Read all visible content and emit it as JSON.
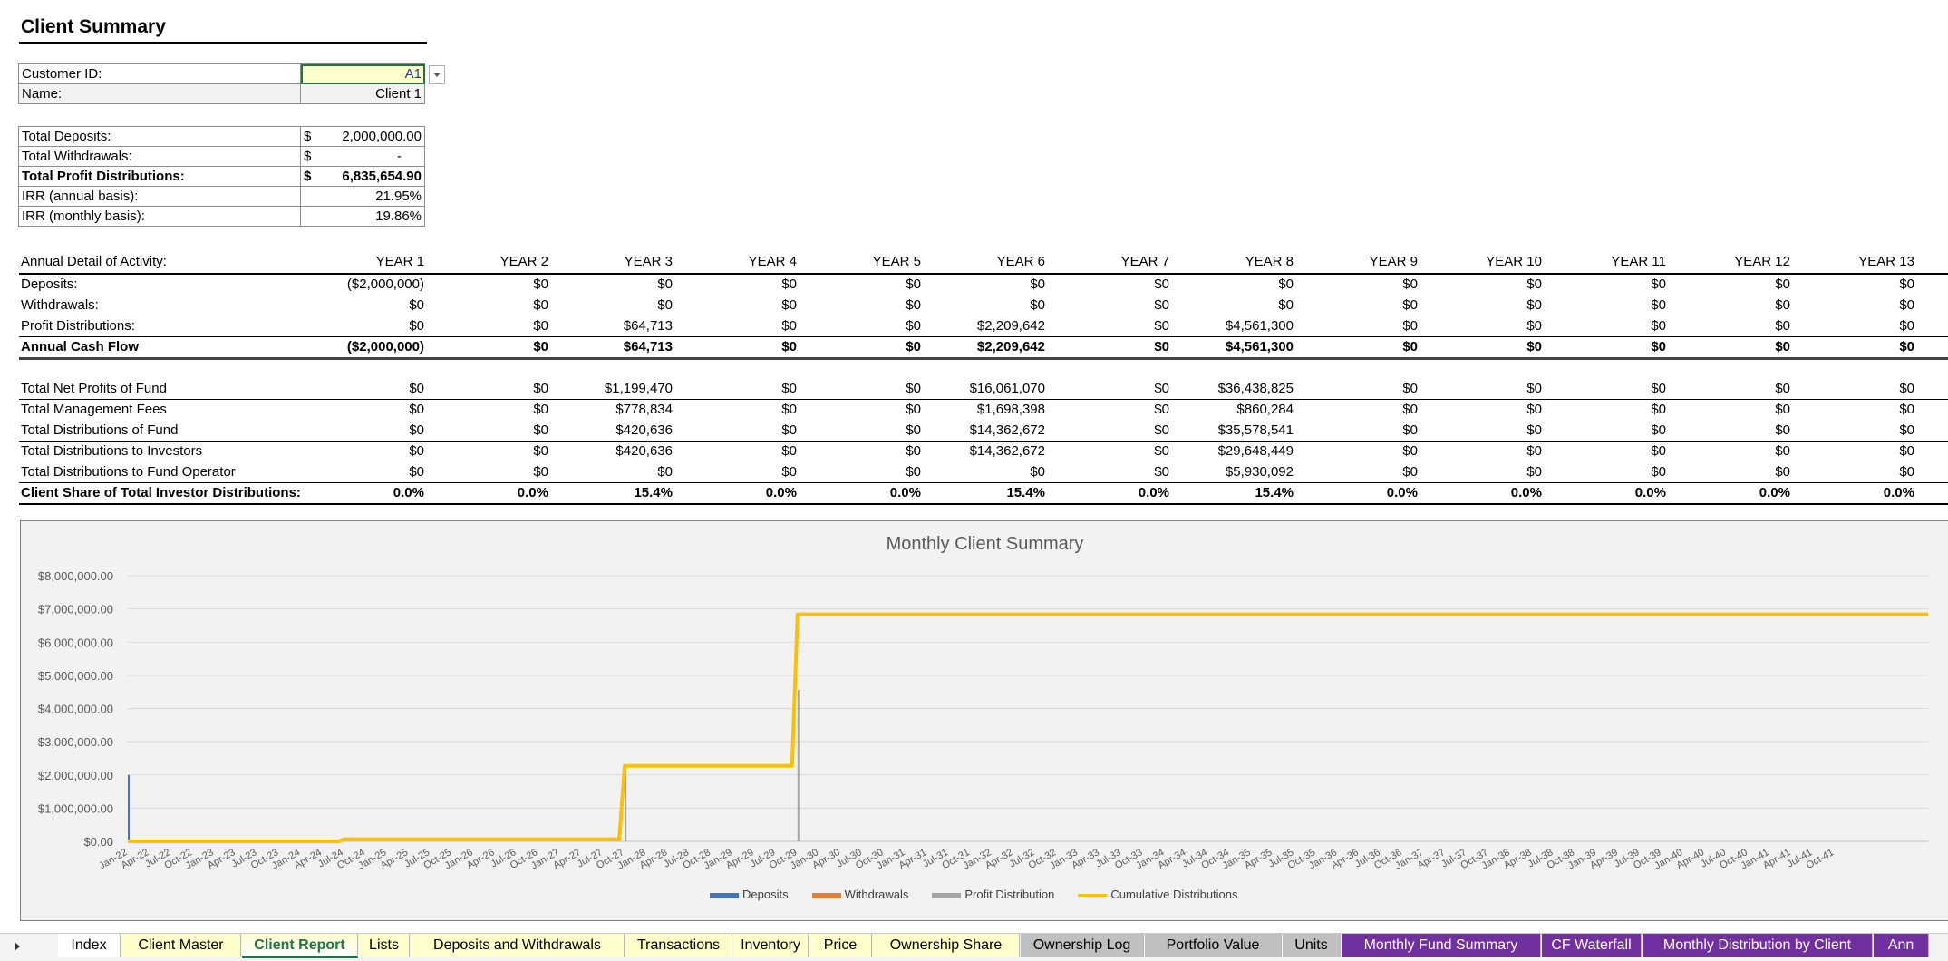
{
  "title": "Client Summary",
  "customer": {
    "id_label": "Customer ID:",
    "id_value": "A1",
    "name_label": "Name:",
    "name_value": "Client 1"
  },
  "totals": [
    {
      "label": "Total Deposits:",
      "currency": "$",
      "amount": "2,000,000.00",
      "bold": false
    },
    {
      "label": "Total Withdrawals:",
      "currency": "$",
      "amount": "-",
      "bold": false
    },
    {
      "label": "Total Profit Distributions:",
      "currency": "$",
      "amount": "6,835,654.90",
      "bold": true
    },
    {
      "label": "IRR (annual basis):",
      "currency": "",
      "amount": "21.95%",
      "bold": false
    },
    {
      "label": "IRR (monthly basis):",
      "currency": "",
      "amount": "19.86%",
      "bold": false
    }
  ],
  "annual": {
    "header_label": "Annual Detail of Activity:",
    "years": [
      "YEAR 1",
      "YEAR 2",
      "YEAR 3",
      "YEAR 4",
      "YEAR 5",
      "YEAR 6",
      "YEAR 7",
      "YEAR 8",
      "YEAR 9",
      "YEAR 10",
      "YEAR 11",
      "YEAR 12",
      "YEAR 13"
    ],
    "rows": [
      {
        "label": "Deposits:",
        "bold": false,
        "values": [
          "($2,000,000)",
          "$0",
          "$0",
          "$0",
          "$0",
          "$0",
          "$0",
          "$0",
          "$0",
          "$0",
          "$0",
          "$0",
          "$0"
        ]
      },
      {
        "label": "Withdrawals:",
        "bold": false,
        "values": [
          "$0",
          "$0",
          "$0",
          "$0",
          "$0",
          "$0",
          "$0",
          "$0",
          "$0",
          "$0",
          "$0",
          "$0",
          "$0"
        ]
      },
      {
        "label": "Profit Distributions:",
        "bold": false,
        "values": [
          "$0",
          "$0",
          "$64,713",
          "$0",
          "$0",
          "$2,209,642",
          "$0",
          "$4,561,300",
          "$0",
          "$0",
          "$0",
          "$0",
          "$0"
        ]
      },
      {
        "label": "Annual Cash Flow",
        "bold": true,
        "values": [
          "($2,000,000)",
          "$0",
          "$64,713",
          "$0",
          "$0",
          "$2,209,642",
          "$0",
          "$4,561,300",
          "$0",
          "$0",
          "$0",
          "$0",
          "$0"
        ]
      }
    ],
    "fund_rows": [
      {
        "label": "Total Net Profits of Fund",
        "bold": false,
        "values": [
          "$0",
          "$0",
          "$1,199,470",
          "$0",
          "$0",
          "$16,061,070",
          "$0",
          "$36,438,825",
          "$0",
          "$0",
          "$0",
          "$0",
          "$0"
        ]
      },
      {
        "label": " Total Management Fees",
        "bold": false,
        "values": [
          "$0",
          "$0",
          "$778,834",
          "$0",
          "$0",
          "$1,698,398",
          "$0",
          "$860,284",
          "$0",
          "$0",
          "$0",
          "$0",
          "$0"
        ]
      },
      {
        "label": " Total Distributions of Fund",
        "bold": false,
        "values": [
          "$0",
          "$0",
          "$420,636",
          "$0",
          "$0",
          "$14,362,672",
          "$0",
          "$35,578,541",
          "$0",
          "$0",
          "$0",
          "$0",
          "$0"
        ]
      },
      {
        "label": " Total Distributions to Investors",
        "bold": false,
        "values": [
          "$0",
          "$0",
          "$420,636",
          "$0",
          "$0",
          "$14,362,672",
          "$0",
          "$29,648,449",
          "$0",
          "$0",
          "$0",
          "$0",
          "$0"
        ]
      },
      {
        "label": " Total Distributions to Fund Operator",
        "bold": false,
        "values": [
          "$0",
          "$0",
          "$0",
          "$0",
          "$0",
          "$0",
          "$0",
          "$5,930,092",
          "$0",
          "$0",
          "$0",
          "$0",
          "$0"
        ]
      },
      {
        "label": "Client Share of Total Investor Distributions:",
        "bold": true,
        "values": [
          "0.0%",
          "0.0%",
          "15.4%",
          "0.0%",
          "0.0%",
          "15.4%",
          "0.0%",
          "15.4%",
          "0.0%",
          "0.0%",
          "0.0%",
          "0.0%",
          "0.0%"
        ]
      }
    ]
  },
  "chart_data": {
    "type": "line",
    "title": "Monthly Client Summary",
    "y_ticks": [
      "$0.00",
      "$1,000,000.00",
      "$2,000,000.00",
      "$3,000,000.00",
      "$4,000,000.00",
      "$5,000,000.00",
      "$6,000,000.00",
      "$7,000,000.00",
      "$8,000,000.00"
    ],
    "ylim": [
      0,
      8000000
    ],
    "x_labels": [
      "Jan-22",
      "Apr-22",
      "Jul-22",
      "Oct-22",
      "Jan-23",
      "Apr-23",
      "Jul-23",
      "Oct-23",
      "Jan-24",
      "Apr-24",
      "Jul-24",
      "Oct-24",
      "Jan-25",
      "Apr-25",
      "Jul-25",
      "Oct-25",
      "Jan-26",
      "Apr-26",
      "Jul-26",
      "Oct-26",
      "Jan-27",
      "Apr-27",
      "Jul-27",
      "Oct-27",
      "Jan-28",
      "Apr-28",
      "Jul-28",
      "Oct-28",
      "Jan-29",
      "Apr-29",
      "Jul-29",
      "Oct-29",
      "Jan-30",
      "Apr-30",
      "Jul-30",
      "Oct-30",
      "Jan-31",
      "Apr-31",
      "Jul-31",
      "Oct-31",
      "Jan-32",
      "Apr-32",
      "Jul-32",
      "Oct-32",
      "Jan-33",
      "Apr-33",
      "Jul-33",
      "Oct-33",
      "Jan-34",
      "Apr-34",
      "Jul-34",
      "Oct-34",
      "Jan-35",
      "Apr-35",
      "Jul-35",
      "Oct-35",
      "Jan-36",
      "Apr-36",
      "Jul-36",
      "Oct-36",
      "Jan-37",
      "Apr-37",
      "Jul-37",
      "Oct-37",
      "Jan-38",
      "Apr-38",
      "Jul-38",
      "Oct-38",
      "Jan-39",
      "Apr-39",
      "Jul-39",
      "Oct-39",
      "Jan-40",
      "Apr-40",
      "Jul-40",
      "Oct-40",
      "Jan-41",
      "Apr-41",
      "Jul-41",
      "Oct-41"
    ],
    "series": [
      {
        "name": "Deposits",
        "color": "#4472c4",
        "points": [
          {
            "x": "Jan-22",
            "y": 2000000
          }
        ]
      },
      {
        "name": "Withdrawals",
        "color": "#ed7d31",
        "points": []
      },
      {
        "name": "Profit Distribution",
        "color": "#a5a5a5",
        "points": [
          {
            "x": "Oct-27",
            "y": 2300000
          },
          {
            "x": "Oct-29",
            "y": 4560000
          }
        ]
      },
      {
        "name": "Cumulative Distributions",
        "color": "#ffc000",
        "steps": [
          {
            "from": "Jan-22",
            "y": 0
          },
          {
            "from": "Jul-24",
            "y": 64713
          },
          {
            "from": "Oct-27",
            "y": 2274355
          },
          {
            "from": "Oct-29",
            "y": 6835655
          }
        ]
      }
    ]
  },
  "tabs": [
    {
      "label": "Index",
      "bg": "#ffffff",
      "fg": "#000000",
      "active": false
    },
    {
      "label": "Client Master",
      "bg": "#ffffcc",
      "fg": "#000000",
      "active": false
    },
    {
      "label": "Client Report",
      "bg": "#ffffcc",
      "fg": "#217346",
      "active": true
    },
    {
      "label": "Lists",
      "bg": "#ffffcc",
      "fg": "#000000",
      "active": false
    },
    {
      "label": "Deposits and Withdrawals",
      "bg": "#ffffcc",
      "fg": "#000000",
      "active": false
    },
    {
      "label": "Transactions",
      "bg": "#ffffcc",
      "fg": "#000000",
      "active": false
    },
    {
      "label": "Inventory",
      "bg": "#ffffcc",
      "fg": "#000000",
      "active": false
    },
    {
      "label": "Price",
      "bg": "#ffffcc",
      "fg": "#000000",
      "active": false
    },
    {
      "label": "Ownership Share",
      "bg": "#ffffcc",
      "fg": "#000000",
      "active": false
    },
    {
      "label": "Ownership Log",
      "bg": "#c0c0c0",
      "fg": "#000000",
      "active": false
    },
    {
      "label": "Portfolio Value",
      "bg": "#c0c0c0",
      "fg": "#000000",
      "active": false
    },
    {
      "label": "Units",
      "bg": "#c0c0c0",
      "fg": "#000000",
      "active": false
    },
    {
      "label": "Monthly Fund Summary",
      "bg": "#7030a0",
      "fg": "#ffffff",
      "active": false
    },
    {
      "label": "CF Waterfall",
      "bg": "#7030a0",
      "fg": "#ffffff",
      "active": false
    },
    {
      "label": "Monthly Distribution by Client",
      "bg": "#7030a0",
      "fg": "#ffffff",
      "active": false
    },
    {
      "label": "Ann",
      "bg": "#7030a0",
      "fg": "#ffffff",
      "active": false
    }
  ]
}
